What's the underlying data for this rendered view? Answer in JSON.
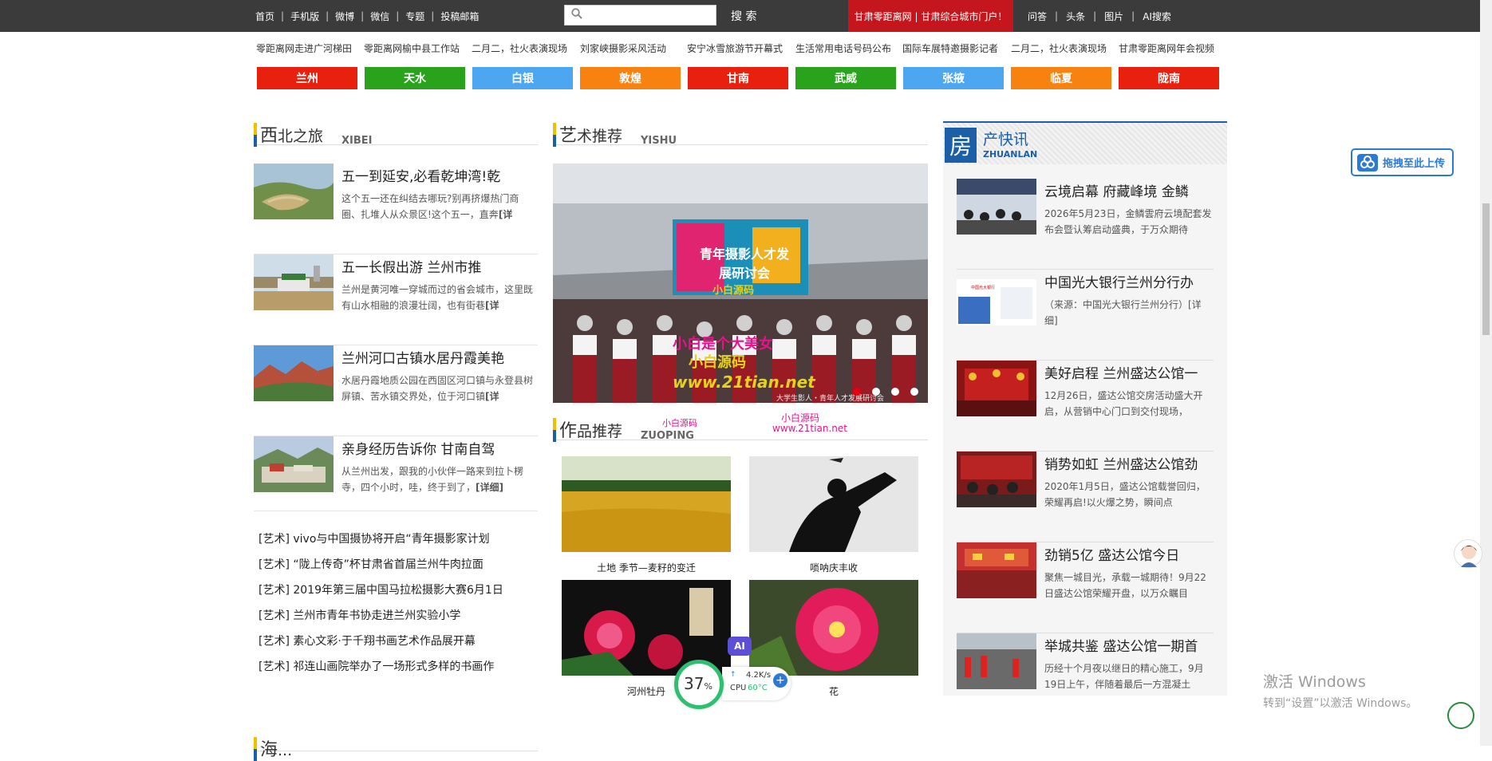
{
  "topbar": {
    "nav": [
      "首页",
      "手机版",
      "微博",
      "微信",
      "专题",
      "投稿邮箱"
    ],
    "search_placeholder": "",
    "search_button": "搜 索",
    "banner": "甘肃零距离网 | 甘肃综合城市门户！",
    "right_nav": [
      "问答",
      "头条",
      "图片",
      "AI搜索"
    ]
  },
  "links": [
    "零距离网走进广河梯田",
    "零距离网榆中县工作站",
    "二月二，社火表演现场",
    "刘家峡摄影采风活动",
    "安宁冰雪旅游节开幕式",
    "生活常用电话号码公布",
    "国际车展特邀摄影记者",
    "二月二，社火表演现场",
    "甘肃零距离网年会视频"
  ],
  "cities": [
    {
      "label": "兰州",
      "color": "#e8210e"
    },
    {
      "label": "天水",
      "color": "#2aa31c"
    },
    {
      "label": "白银",
      "color": "#4da6f0"
    },
    {
      "label": "敦煌",
      "color": "#f7820f"
    },
    {
      "label": "甘南",
      "color": "#e8210e"
    },
    {
      "label": "武威",
      "color": "#2aa31c"
    },
    {
      "label": "张掖",
      "color": "#4da6f0"
    },
    {
      "label": "临夏",
      "color": "#f7820f"
    },
    {
      "label": "陇南",
      "color": "#e8210e"
    }
  ],
  "xibei": {
    "head_big": "西",
    "head_rest": "北之旅",
    "head_en": "XIBEI",
    "articles": [
      {
        "title": "五一到延安,必看乾坤湾!乾",
        "desc": "这个五一还在纠结去哪玩?别再挤爆热门商圈、扎堆人从众景区!这个五一，直奔",
        "more": "[详"
      },
      {
        "title": "五一长假出游 兰州市推",
        "desc": "兰州是黄河唯一穿城而过的省会城市，这里既有山水相融的浪漫壮阔，也有街巷",
        "more": "[详"
      },
      {
        "title": "兰州河口古镇水居丹霞美艳",
        "desc": "水居丹霞地质公园在西固区河口镇与永登县树屏镇、苦水镇交界处，位于河口镇",
        "more": "[详"
      },
      {
        "title": "亲身经历告诉你 甘南自驾",
        "desc": "从兰州出发，跟我的小伙伴一路来到拉卜楞寺，四个小时，哇，终于到了，",
        "more": "[详细]"
      }
    ],
    "list": [
      "[艺术] vivo与中国摄协将开启“青年摄影家计划",
      "[艺术] “陇上传奇”杯甘肃省首届兰州牛肉拉面",
      "[艺术] 2019年第三届中国马拉松摄影大赛6月1日",
      "[艺术] 兰州市青年书协走进兰州实验小学",
      "[艺术] 素心文彩·于千翔书画艺术作品展开幕",
      "[艺术] 祁连山画院举办了一场形式多样的书画作"
    ]
  },
  "yishu": {
    "head_big": "艺",
    "head_rest": "术推荐",
    "head_en": "YISHU",
    "slide_banner": "青年摄影人才发展研讨会",
    "slide_caption": "大学生影人・青年人才发展研讨会",
    "wm_lines": [
      "小白源码",
      "小白是个大美女",
      "小白源码",
      "www.21tian.net"
    ]
  },
  "zuoping": {
    "head_big": "作",
    "head_rest": "品推荐",
    "head_en": "ZUOPING",
    "wm": [
      "小白源码",
      "小白源码",
      "www.21tian.net"
    ],
    "works": [
      "土地 季节—麦籽的变迁",
      "唢呐庆丰收",
      "河州牡丹",
      "花"
    ]
  },
  "fangchan": {
    "head_big": "房",
    "head_rest": "产快讯",
    "head_en": "ZHUANLAN",
    "articles": [
      {
        "title": "云境启幕 府藏峰境 金鳞",
        "desc": "2026年5月23日，金鳞雲府云境配套发布会暨认筹启动盛典，于万众期待"
      },
      {
        "title": "中国光大银行兰州分行办",
        "desc": "（来源：中国光大银行兰州分行）[详细]"
      },
      {
        "title": "美好启程 兰州盛达公馆一",
        "desc": "12月26日，盛达公馆交房活动盛大开启，从营销中心门口到交付现场，"
      },
      {
        "title": "销势如虹 兰州盛达公馆劲",
        "desc": "2020年1月5日，盛达公馆载誉回归，荣耀再启!以火爆之势，瞬间点"
      },
      {
        "title": "劲销5亿 盛达公馆今日",
        "desc": "聚焦一城目光，承载一城期待！9月22日盛达公馆荣耀开盘，以万众瞩目"
      },
      {
        "title": "举城共鉴 盛达公馆一期首",
        "desc": "历经十个月夜以继日的精心施工，9月19日上午，伴随着最后一方混凝土"
      }
    ]
  },
  "overlay": {
    "upload": "拖拽至此上传",
    "ai": "AI",
    "cpu_pct": "37",
    "pct_sign": "%",
    "net_speed": "4.2K/s",
    "cpu_label": "CPU",
    "cpu_temp": "60°C",
    "win_line1": "激活 Windows",
    "win_line2": "转到“设置”以激活 Windows。",
    "next_head_big": "海",
    "next_head_rest": "..."
  }
}
